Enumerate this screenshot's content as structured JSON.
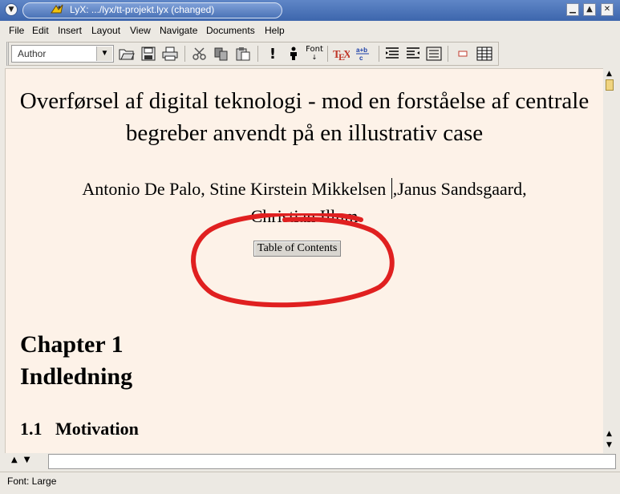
{
  "window": {
    "title": "LyX: .../lyx/tt-projekt.lyx (changed)",
    "buttons": {
      "minimize": "▁",
      "maximize": "▲",
      "close": "✕",
      "menu": "▼"
    }
  },
  "menubar": {
    "items": [
      {
        "label": "File"
      },
      {
        "label": "Edit"
      },
      {
        "label": "Insert"
      },
      {
        "label": "Layout"
      },
      {
        "label": "View"
      },
      {
        "label": "Navigate"
      },
      {
        "label": "Documents"
      },
      {
        "label": "Help"
      }
    ]
  },
  "toolbar": {
    "paragraph_style": "Author",
    "font_label": "Font",
    "icons": [
      "open-icon",
      "save-icon",
      "print-icon",
      "cut-icon",
      "copy-icon",
      "paste-icon",
      "emphasis-icon",
      "noun-icon",
      "font-icon",
      "tex-icon",
      "math-icon",
      "depth-decrease-icon",
      "depth-increase-icon",
      "paragraph-icon",
      "float-icon",
      "table-icon"
    ]
  },
  "document": {
    "title": "Overførsel af digital teknologi - mod en forståelse af centrale begreber anvendt på en illustrativ case",
    "author_line1_a": "Antonio De Palo, Stine Kirstein Mikkelsen ",
    "author_line1_b": ",Janus Sandsgaard,",
    "author_line2": "Christian Illum",
    "toc_button": "Table of Contents",
    "chapter_label": "Chapter 1",
    "chapter_title": "Indledning",
    "section": "1.1   Motivation"
  },
  "status": {
    "text": "Font: Large"
  },
  "colors": {
    "titlebar": "#4a72b5",
    "editor_bg": "#fdf2e8",
    "annotation": "#e02020"
  }
}
